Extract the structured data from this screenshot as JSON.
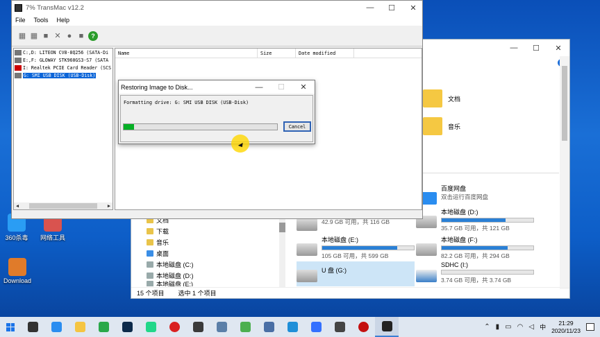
{
  "desktop": {
    "icons": [
      {
        "label": "360杀毒",
        "color": "#2a9df4"
      },
      {
        "label": "网络工具",
        "color": "#d9534f"
      },
      {
        "label": "Download",
        "color": "#e07b2a"
      }
    ]
  },
  "explorer": {
    "help": "?",
    "controls": {
      "min": "—",
      "max": "☐",
      "close": "✕"
    },
    "folders": [
      {
        "label": "文档"
      },
      {
        "label": "音乐"
      }
    ],
    "nav_items": [
      {
        "label": "文档",
        "type": "folder"
      },
      {
        "label": "下载",
        "type": "folder"
      },
      {
        "label": "音乐",
        "type": "folder"
      },
      {
        "label": "桌面",
        "type": "folder"
      },
      {
        "label": "本地磁盘 (C:)",
        "type": "drive"
      },
      {
        "label": "本地磁盘 (D:)",
        "type": "drive"
      },
      {
        "label": "本地磁盘 (E:)",
        "type": "drive"
      }
    ],
    "drives": [
      {
        "name": "",
        "cap": "42.9 GB 可用，共 116 GB",
        "used": 0.63
      },
      {
        "name": "百度网盘",
        "cap": "双击运行百度网盘",
        "used": null
      },
      {
        "name": "本地磁盘 (D:)",
        "cap": "35.7 GB 可用，共 121 GB",
        "used": 0.7
      },
      {
        "name": "本地磁盘 (E:)",
        "cap": "105 GB 可用，共 599 GB",
        "used": 0.82
      },
      {
        "name": "本地磁盘 (F:)",
        "cap": "82.2 GB 可用，共 294 GB",
        "used": 0.72
      },
      {
        "name": "U 盘 (G:)",
        "cap": "",
        "used": null
      },
      {
        "name": "SDHC (I:)",
        "cap": "3.74 GB 可用，共 3.74 GB",
        "used": 0.0
      }
    ],
    "status": {
      "count": "15 个项目",
      "selected": "选中 1 个项目"
    }
  },
  "transmac": {
    "title": "7% TransMac v12.2",
    "menu": [
      "File",
      "Tools",
      "Help"
    ],
    "controls": {
      "min": "—",
      "max": "☐",
      "close": "✕"
    },
    "drives": [
      {
        "label": "C:,D:  LITEON CV8-8Q256 (SATA-Di",
        "sd": false,
        "selected": false
      },
      {
        "label": "E:,F:  GLOWAY STK960GS3-S7 (SATA",
        "sd": false,
        "selected": false
      },
      {
        "label": "I: Realtek PCIE Card Reader (SCS",
        "sd": true,
        "selected": false
      },
      {
        "label": "G: SMI USB DISK (USB-Disk)",
        "sd": false,
        "selected": true
      }
    ],
    "columns": {
      "name": "Name",
      "size": "Size",
      "date": "Date modified"
    }
  },
  "dialog": {
    "title": "Restoring Image to Disk...",
    "message": "Formatting drive: G: SMI USB DISK (USB-Disk)",
    "progress": 0.07,
    "cancel_label": "Cancel",
    "controls": {
      "min": "—",
      "max": "☐",
      "close": "✕"
    }
  },
  "taskbar": {
    "apps": [
      {
        "name": "search-icon",
        "color": "#333333"
      },
      {
        "name": "baidu-netdisk-icon",
        "color": "#2a8df0"
      },
      {
        "name": "file-explorer-icon",
        "color": "#f5c542"
      },
      {
        "name": "green-app-icon",
        "color": "#2aa84a"
      },
      {
        "name": "photoshop-icon",
        "color": "#0c2a4a"
      },
      {
        "name": "pycharm-icon",
        "color": "#21d789"
      },
      {
        "name": "record-icon",
        "color": "#d92020"
      },
      {
        "name": "terminal-icon",
        "color": "#3a3a3a"
      },
      {
        "name": "archive-icon",
        "color": "#5b7fa8"
      },
      {
        "name": "recycle-icon",
        "color": "#4caf50"
      },
      {
        "name": "chrome-like-icon",
        "color": "#4a6fa5"
      },
      {
        "name": "edge-icon",
        "color": "#1f8fd8"
      },
      {
        "name": "feishu-icon",
        "color": "#3370ff"
      },
      {
        "name": "settings-icon",
        "color": "#444444"
      },
      {
        "name": "obs-icon",
        "color": "#c41010"
      },
      {
        "name": "transmac-icon",
        "color": "#222222"
      }
    ],
    "time": "21:29",
    "date": "2020/11/23",
    "ime": "中"
  }
}
